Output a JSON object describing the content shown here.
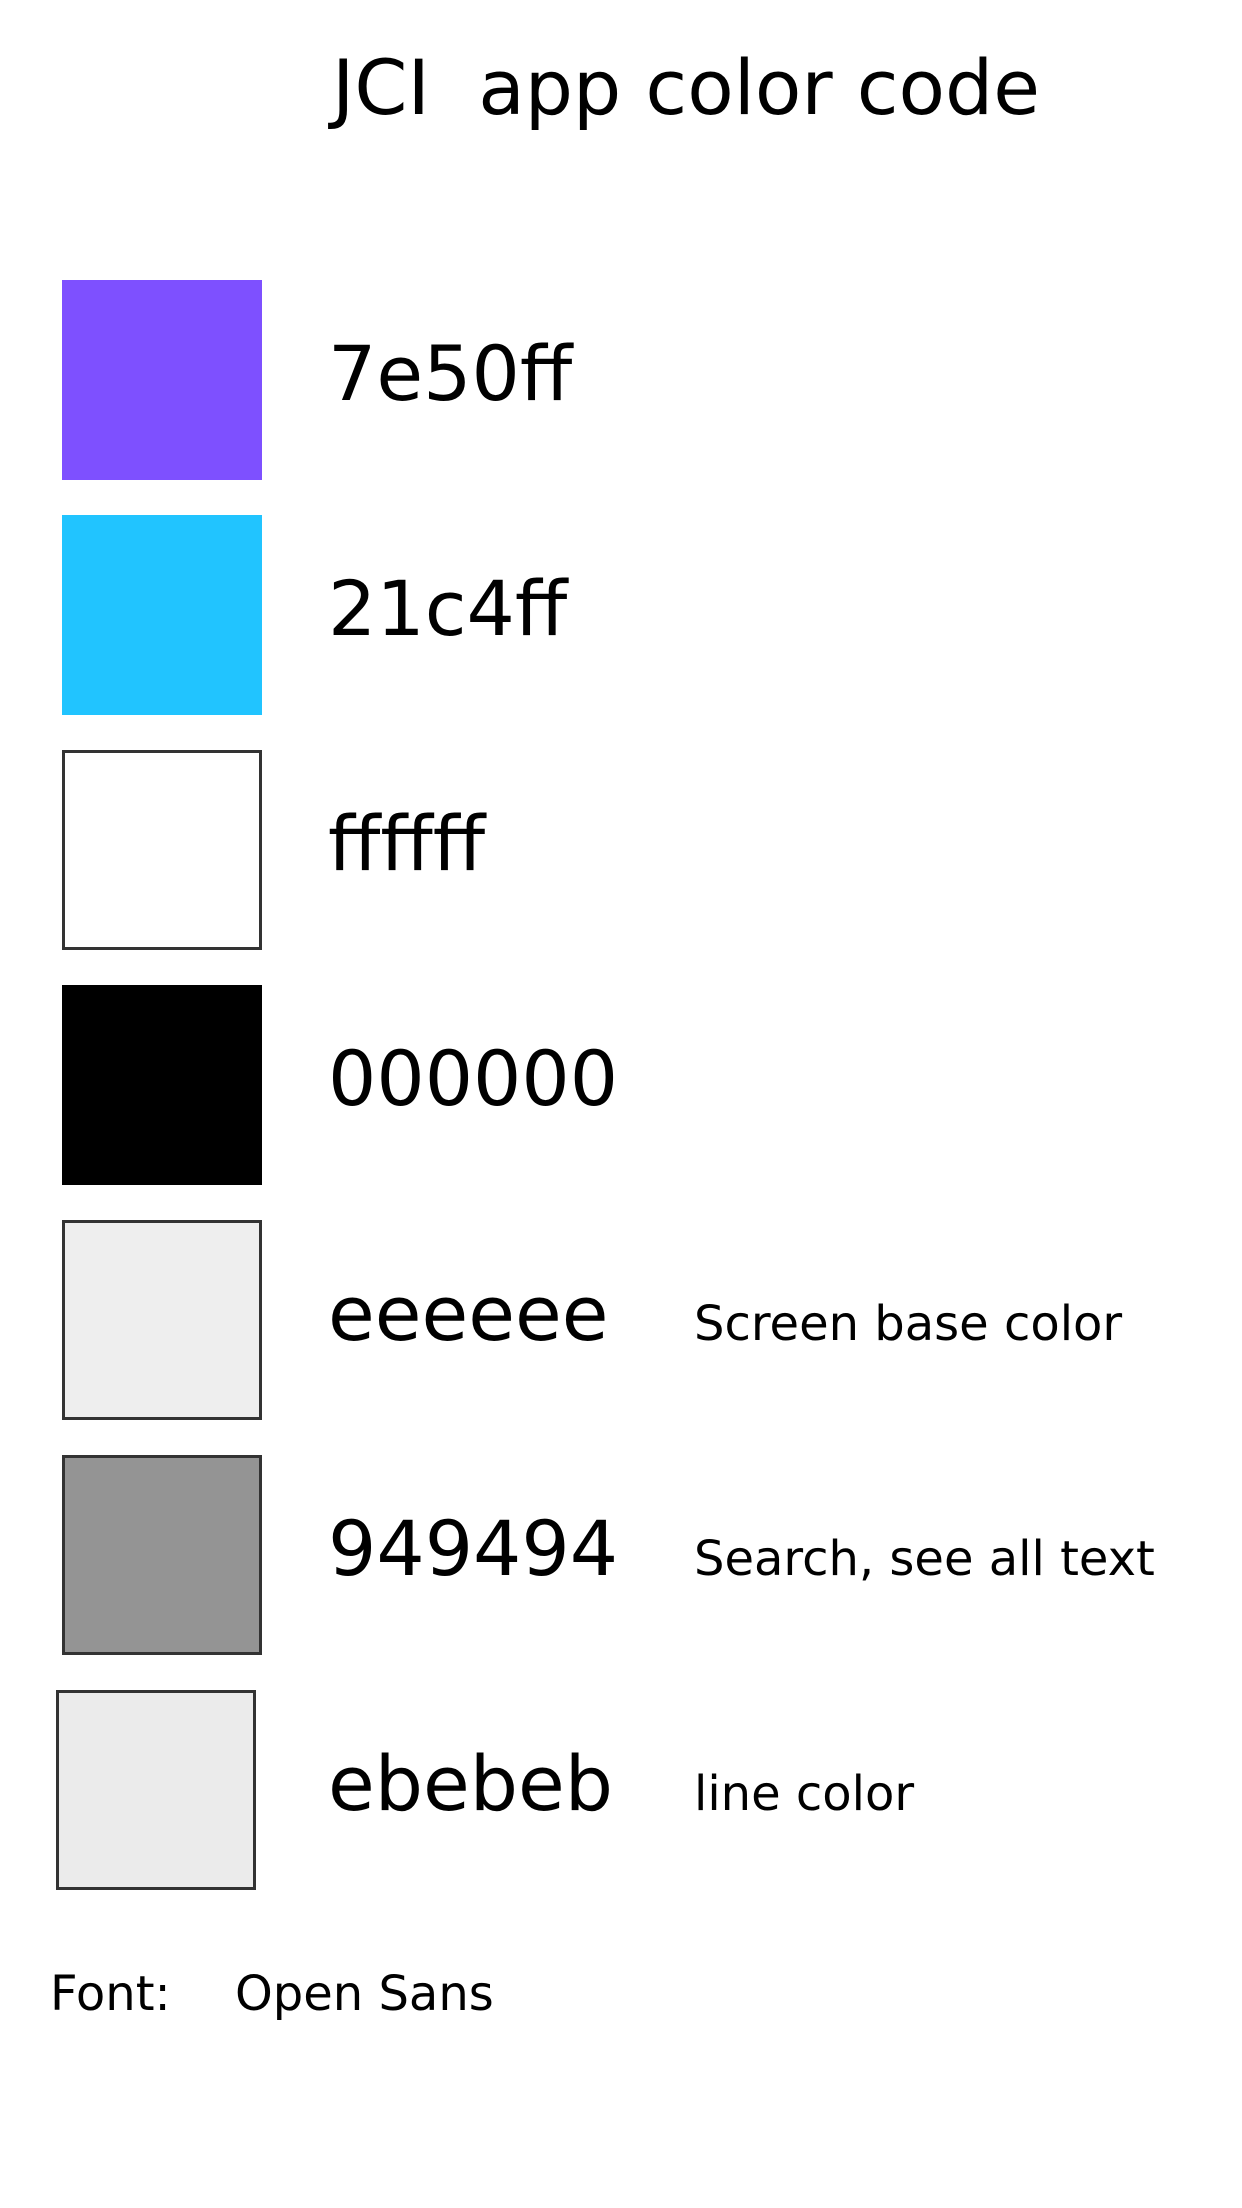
{
  "title": "JCI  app color code",
  "colors": [
    {
      "hex": "7e50ff",
      "swatch": "#7e50ff",
      "note": ""
    },
    {
      "hex": "21c4ff",
      "swatch": "#21c4ff",
      "note": ""
    },
    {
      "hex": "ffffff",
      "swatch": "#ffffff",
      "note": ""
    },
    {
      "hex": "000000",
      "swatch": "#000000",
      "note": ""
    },
    {
      "hex": "eeeeee",
      "swatch": "#eeeeee",
      "note": "Screen base color"
    },
    {
      "hex": "949494",
      "swatch": "#949494",
      "note": "Search, see all text"
    },
    {
      "hex": "ebebeb",
      "swatch": "#ebebeb",
      "note": "line color"
    }
  ],
  "font": {
    "label": "Font:",
    "value": "Open Sans"
  }
}
